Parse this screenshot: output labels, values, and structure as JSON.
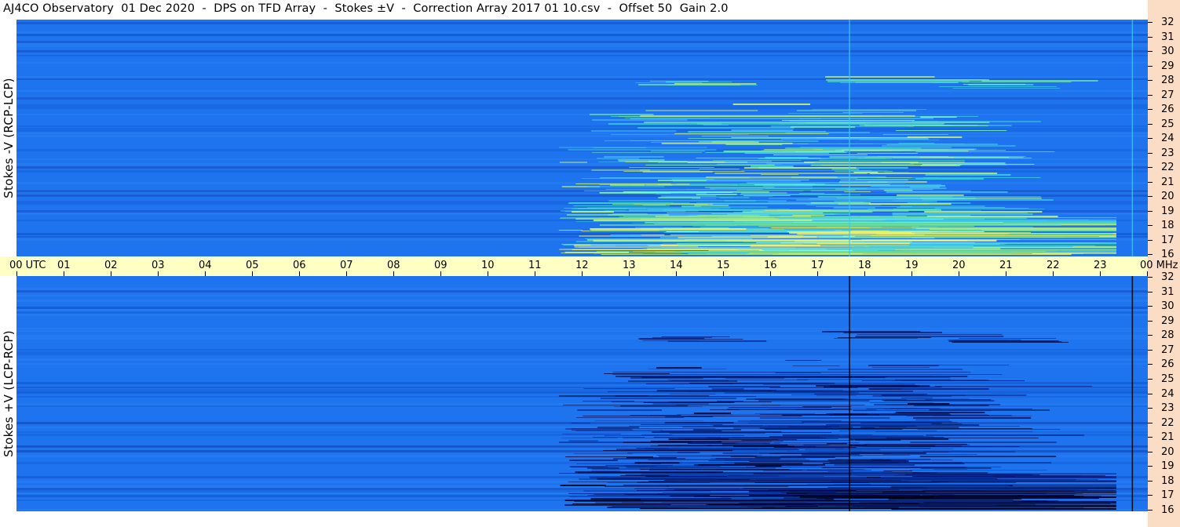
{
  "title": "AJ4CO Observatory  01 Dec 2020  -  DPS on TFD Array  -  Stokes ±V  -  Correction Array 2017 01 10.csv  -  Offset 50  Gain 2.0",
  "chart_data": [
    {
      "type": "heatmap",
      "panel": "top",
      "ylabel": "Stokes -V (RCP-LCP)",
      "y_unit": "MHz",
      "ylim": [
        16,
        32
      ],
      "y_ticks": [
        "32",
        "31",
        "30",
        "29",
        "28",
        "27",
        "26",
        "25",
        "24",
        "23",
        "22",
        "21",
        "20",
        "19",
        "18",
        "17",
        "16"
      ],
      "x_ticks": [
        "00 UTC",
        "01",
        "02",
        "03",
        "04",
        "05",
        "06",
        "07",
        "08",
        "09",
        "10",
        "11",
        "12",
        "13",
        "14",
        "15",
        "16",
        "17",
        "18",
        "19",
        "20",
        "21",
        "22",
        "23",
        "00 MHz"
      ],
      "xlim_hours_utc": [
        0,
        24
      ],
      "colors": {
        "background": "#1e73ee",
        "activity": "#5fe0a0",
        "strong": "#f0f070",
        "vertical_line": "#40c8f0"
      }
    },
    {
      "type": "heatmap",
      "panel": "bottom",
      "ylabel": "Stokes +V (LCP-RCP)",
      "y_unit": "MHz",
      "ylim": [
        16,
        32
      ],
      "y_ticks": [
        "32",
        "31",
        "30",
        "29",
        "28",
        "27",
        "26",
        "25",
        "24",
        "23",
        "22",
        "21",
        "20",
        "19",
        "18",
        "17",
        "16"
      ],
      "xlim_hours_utc": [
        0,
        24
      ],
      "colors": {
        "background": "#1e73ee",
        "activity": "#0a1a6a",
        "strong": "#000020",
        "vertical_line": "#000000"
      }
    }
  ],
  "colors": {
    "time_band": "#ffffc4",
    "right_strip": "#fbdcc4"
  }
}
